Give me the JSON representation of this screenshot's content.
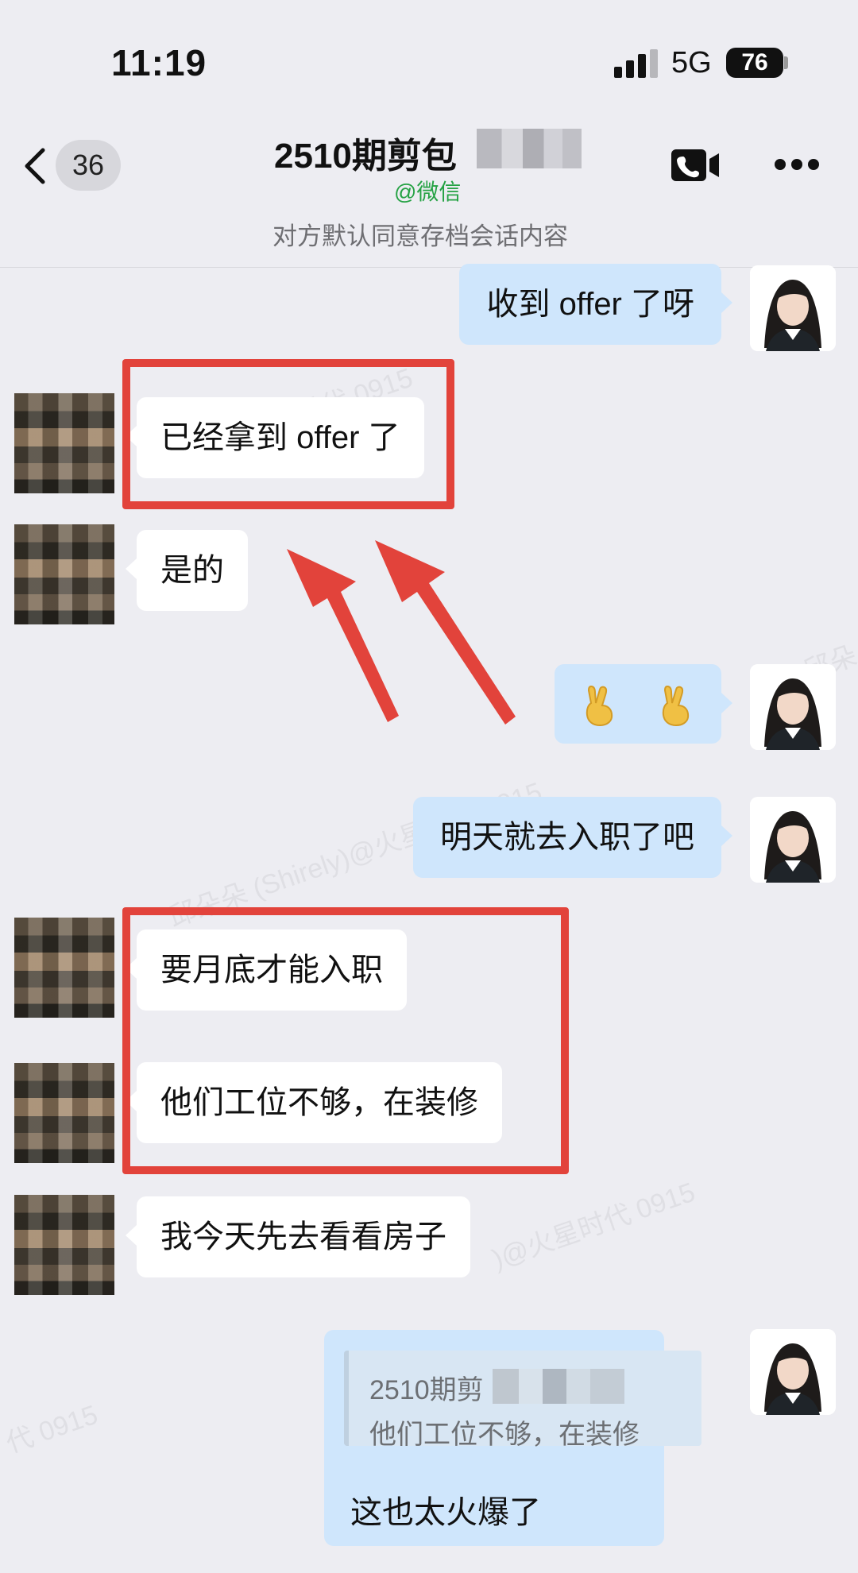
{
  "status_bar": {
    "time": "11:19",
    "network": "5G",
    "battery": "76"
  },
  "header": {
    "unread_count": "36",
    "title": "2510期剪包",
    "source": "@微信",
    "archive_notice": "对方默认同意存档会话内容"
  },
  "messages": [
    {
      "side": "self",
      "text": "收到 offer 了呀"
    },
    {
      "side": "other",
      "text": "已经拿到 offer 了"
    },
    {
      "side": "other",
      "text": "是的"
    },
    {
      "side": "self",
      "emoji": "victory-hand-icon",
      "count": 2
    },
    {
      "side": "self",
      "text": "明天就去入职了吧"
    },
    {
      "side": "other",
      "text": "要月底才能入职"
    },
    {
      "side": "other",
      "text": "他们工位不够，在装修"
    },
    {
      "side": "other",
      "text": "我今天先去看看房子"
    },
    {
      "side": "self",
      "quote_name": "2510期剪",
      "quote_text": "他们工位不够，在装修",
      "text": "这也太火爆了"
    }
  ],
  "watermark": {
    "text_1": "火星时代 0915",
    "text_2": "邱朵朵 (Shirely)@火星时代 0915",
    "text_3": ")@火星时代 0915",
    "text_4": "邱朵",
    "text_5": "代 0915"
  },
  "colors": {
    "background": "#ededf2",
    "incoming_bubble": "#ffffff",
    "outgoing_bubble": "#cfe6fc",
    "source_green": "#25a244",
    "annotation_red": "#e2433b"
  }
}
